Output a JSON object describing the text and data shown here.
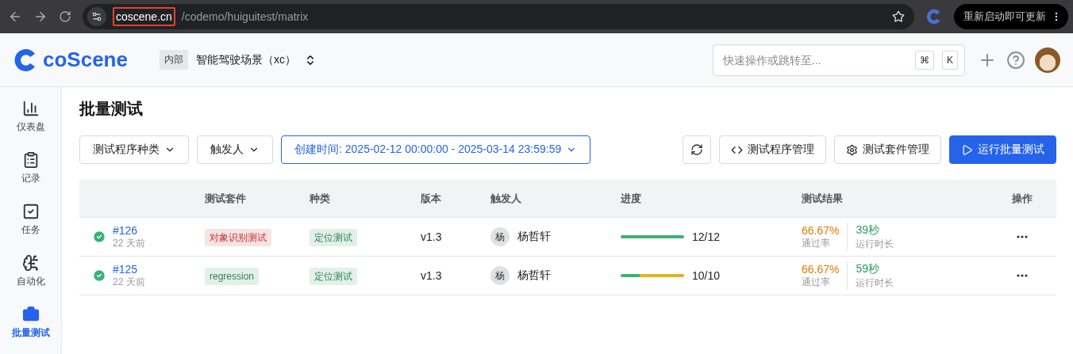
{
  "browser": {
    "url_host": "coscene.cn",
    "url_path": "/codemo/huiguitest/matrix",
    "update_button": "重新启动即可更新"
  },
  "header": {
    "logo": "coScene",
    "project_badge": "内部",
    "project_name": "智能驾驶场景（xc）",
    "search": {
      "placeholder": "快速操作或跳转至...",
      "keys": [
        "⌘",
        "K"
      ]
    }
  },
  "sidebar": {
    "items": [
      {
        "label": "仪表盘",
        "selected": false
      },
      {
        "label": "记录",
        "selected": false
      },
      {
        "label": "任务",
        "selected": false
      },
      {
        "label": "自动化",
        "selected": false
      },
      {
        "label": "批量测试",
        "selected": true
      }
    ]
  },
  "page": {
    "title": "批量测试",
    "filters": [
      {
        "label": "测试程序种类",
        "kind": "dropdown"
      },
      {
        "label": "触发人",
        "kind": "dropdown"
      },
      {
        "label": "创建时间: 2025-02-12 00:00:00 - 2025-03-14 23:59:59",
        "kind": "active"
      }
    ],
    "actions": [
      {
        "label": "测试程序管理",
        "kind": "code"
      },
      {
        "label": "测试套件管理",
        "kind": "gear"
      },
      {
        "label": "运行批量测试",
        "kind": "primary"
      }
    ]
  },
  "table": {
    "columns": [
      "",
      "测试套件",
      "种类",
      "版本",
      "触发人",
      "进度",
      "测试结果",
      "操作"
    ],
    "rows": [
      {
        "id": "#126",
        "time": "22 天前",
        "suite": {
          "text": "对象识别测试",
          "color": "#c53030"
        },
        "type": {
          "text": "定位测试"
        },
        "version": "v1.3",
        "avatar": "杨",
        "trigger": "杨哲轩",
        "progress": {
          "text": "12/12",
          "segments": [
            {
              "color": "#38b27a",
              "level": 1
            }
          ]
        },
        "pass_rate": "66.67%",
        "pass_label": "通过率",
        "duration": "39秒",
        "duration_label": "运行时长"
      },
      {
        "id": "#125",
        "time": "22 天前",
        "suite": {
          "text": "regression",
          "color": "#2f855a"
        },
        "type": {
          "text": "定位测试"
        },
        "version": "v1.3",
        "avatar": "杨",
        "trigger": "杨哲轩",
        "progress": {
          "text": "10/10",
          "segments": [
            {
              "color": "#38b27a",
              "level": 0.3
            },
            {
              "color": "#e6b21a",
              "level": 0.7
            }
          ]
        },
        "pass_rate": "66.67%",
        "pass_label": "通过率",
        "duration": "59秒",
        "duration_label": "运行时长"
      }
    ]
  }
}
